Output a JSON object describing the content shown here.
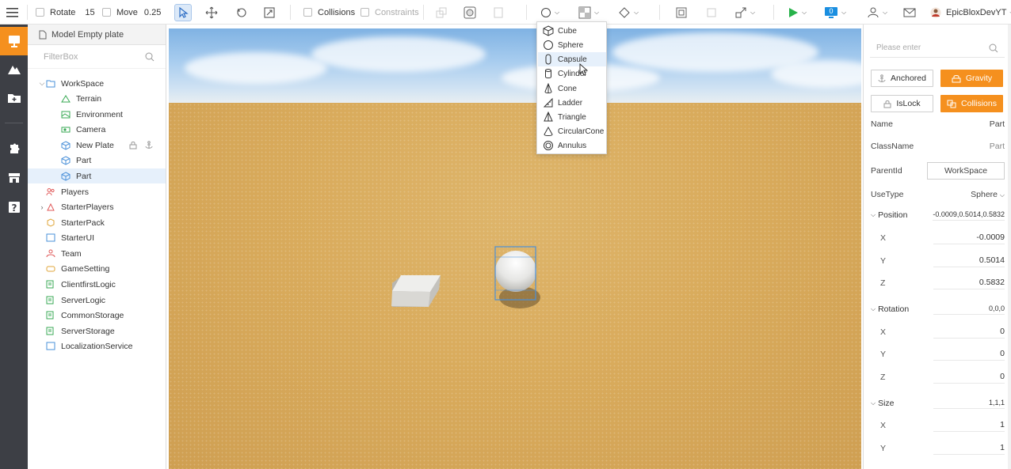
{
  "toolbar": {
    "rotate_label": "Rotate",
    "rotate_value": "15",
    "move_label": "Move",
    "move_value": "0.25",
    "collisions_label": "Collisions",
    "constraints_label": "Constraints",
    "notification_count": "0",
    "user_name": "EpicBloxDevYT"
  },
  "explorer": {
    "title": "Model Empty plate",
    "filter_placeholder": "FilterBox",
    "items": [
      {
        "label": "WorkSpace",
        "icon": "folder-icon"
      },
      {
        "label": "Terrain",
        "icon": "terrain-icon"
      },
      {
        "label": "Environment",
        "icon": "environment-icon"
      },
      {
        "label": "Camera",
        "icon": "camera-icon"
      },
      {
        "label": "New Plate",
        "icon": "part-icon"
      },
      {
        "label": "Part",
        "icon": "part-icon"
      },
      {
        "label": "Part",
        "icon": "part-icon"
      },
      {
        "label": "Players",
        "icon": "players-icon"
      },
      {
        "label": "StarterPlayers",
        "icon": "starter-players-icon"
      },
      {
        "label": "StarterPack",
        "icon": "starter-pack-icon"
      },
      {
        "label": "StarterUI",
        "icon": "starter-ui-icon"
      },
      {
        "label": "Team",
        "icon": "team-icon"
      },
      {
        "label": "GameSetting",
        "icon": "game-setting-icon"
      },
      {
        "label": "ClientfirstLogic",
        "icon": "script-icon"
      },
      {
        "label": "ServerLogic",
        "icon": "script-icon"
      },
      {
        "label": "CommonStorage",
        "icon": "storage-icon"
      },
      {
        "label": "ServerStorage",
        "icon": "storage-icon"
      },
      {
        "label": "LocalizationService",
        "icon": "localization-icon"
      }
    ]
  },
  "shape_menu": {
    "items": [
      "Cube",
      "Sphere",
      "Capsule",
      "Cylinder",
      "Cone",
      "Ladder",
      "Triangle",
      "CircularCone",
      "Annulus"
    ]
  },
  "properties": {
    "search_placeholder": "Please enter",
    "anchored_label": "Anchored",
    "gravity_label": "Gravity",
    "islock_label": "IsLock",
    "collisions_label": "Collisions",
    "name_key": "Name",
    "name_value": "Part",
    "classname_key": "ClassName",
    "classname_value": "Part",
    "parentid_key": "ParentId",
    "parentid_value": "WorkSpace",
    "usetype_key": "UseType",
    "usetype_value": "Sphere",
    "position_key": "Position",
    "position_value": "-0.0009,0.5014,0.5832",
    "pos_x_key": "X",
    "pos_x": "-0.0009",
    "pos_y_key": "Y",
    "pos_y": "0.5014",
    "pos_z_key": "Z",
    "pos_z": "0.5832",
    "rotation_key": "Rotation",
    "rotation_value": "0,0,0",
    "rot_x_key": "X",
    "rot_x": "0",
    "rot_y_key": "Y",
    "rot_y": "0",
    "rot_z_key": "Z",
    "rot_z": "0",
    "size_key": "Size",
    "size_value": "1,1,1",
    "size_x_key": "X",
    "size_x": "1",
    "size_y_key": "Y",
    "size_y": "1"
  },
  "colors": {
    "accent": "#f5901e",
    "sidebar": "#3d3f45",
    "selection": "#e6f0fb"
  }
}
